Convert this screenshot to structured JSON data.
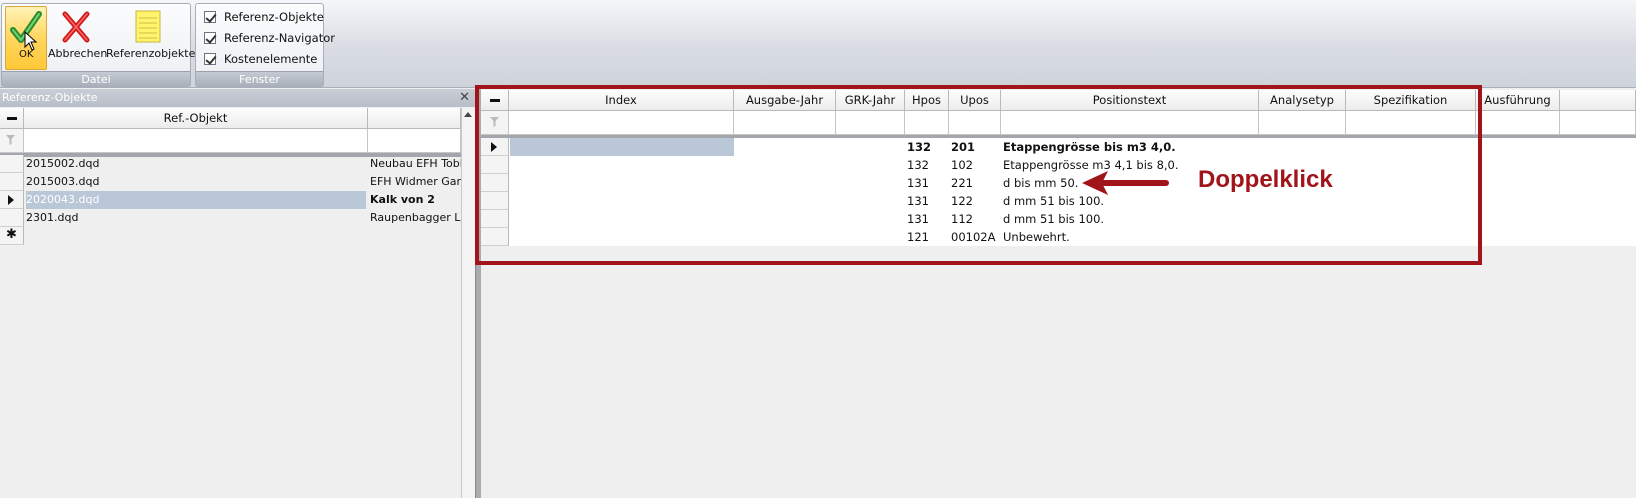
{
  "ribbon": {
    "datei_group": {
      "label": "Datei",
      "ok_label": "OK",
      "cancel_label": "Abbrechen",
      "refs_label": "Referenzobjekte"
    },
    "fenster_group": {
      "label": "Fenster",
      "checkboxes": [
        {
          "label": "Referenz-Objekte",
          "checked": true
        },
        {
          "label": "Referenz-Navigator",
          "checked": true
        },
        {
          "label": "Kostenelemente",
          "checked": true
        }
      ]
    }
  },
  "left_panel": {
    "title": "Referenz-Objekte",
    "column_header": "Ref.-Objekt",
    "rows": [
      {
        "file": "2015002.dqd",
        "name": "Neubau EFH Tobler"
      },
      {
        "file": "2015003.dqd",
        "name": "EFH Widmer Garten"
      },
      {
        "file": "2020043.dqd",
        "name": "Kalk von 2",
        "selected": true
      },
      {
        "file": "2301.dqd",
        "name": "Raupenbagger Lieb"
      }
    ]
  },
  "right_panel": {
    "columns": [
      "Index",
      "Ausgabe-Jahr",
      "GRK-Jahr",
      "Hpos",
      "Upos",
      "Positionstext",
      "Analysetyp",
      "Spezifikation",
      "Ausführung"
    ],
    "rows": [
      {
        "hpos": "132",
        "upos": "201",
        "text": "Etappengrösse bis m3 4,0.",
        "bold": true,
        "current": true
      },
      {
        "hpos": "132",
        "upos": "102",
        "text": "Etappengrösse m3 4,1 bis 8,0."
      },
      {
        "hpos": "131",
        "upos": "221",
        "text": "d bis mm 50."
      },
      {
        "hpos": "131",
        "upos": "122",
        "text": "d mm 51 bis 100."
      },
      {
        "hpos": "131",
        "upos": "112",
        "text": "d mm 51 bis 100."
      },
      {
        "hpos": "121",
        "upos": "00102A",
        "text": "Unbewehrt."
      }
    ]
  },
  "annotation": {
    "text": "Doppelklick",
    "color": "#a0141a"
  }
}
